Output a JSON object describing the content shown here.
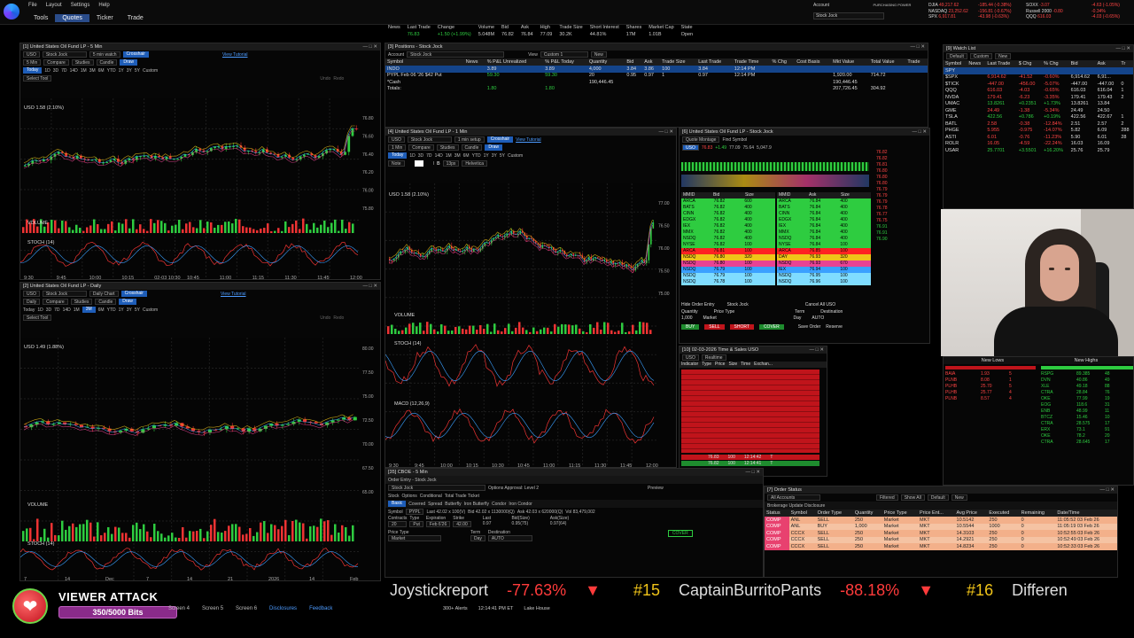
{
  "menu": {
    "items": [
      "File",
      "Layout",
      "Settings",
      "Help"
    ]
  },
  "nav": {
    "tabs": [
      "Tools",
      "Quotes",
      "Ticker",
      "Trade"
    ],
    "active": "Quotes"
  },
  "account": {
    "label": "Account",
    "value": "Stock Jock",
    "power_label": "PURCHASING POWER"
  },
  "indices": [
    {
      "name": "DJIA",
      "value": "49,217.62",
      "chg": "-185.44 (-0.38%)",
      "dir": "down"
    },
    {
      "name": "NASDAQ",
      "value": "23,252.62",
      "chg": "-156.81 (-0.67%)",
      "dir": "down"
    },
    {
      "name": "SPX",
      "value": "6,917.81",
      "chg": "-43.98 (-0.63%)",
      "dir": "down"
    },
    {
      "name": "SOXX",
      "value": "-3.07",
      "chg": "-4.63 (-1.05%)",
      "dir": "down"
    },
    {
      "name": "Russell 2000",
      "value": "-0.80",
      "chg": "-0.34%",
      "dir": "down"
    },
    {
      "name": "QQQ",
      "value": "616.03",
      "chg": "-4.03 (-0.65%)",
      "dir": "down"
    }
  ],
  "header_quote": {
    "labels": [
      "News",
      "Last Trade",
      "Change",
      "Volume",
      "Bid",
      "Ask",
      "High",
      "Trade Size",
      "Short Interest",
      "Shares",
      "Market Cap",
      "State"
    ],
    "values": [
      "",
      "76.83",
      "+1.50 (+1.99%)",
      "5.048M",
      "76.82",
      "76.84",
      "77.09",
      "30.2K",
      "44.81%",
      "17M",
      "1.01B",
      "Open"
    ]
  },
  "chart1": {
    "title": "[1] United States Oil Fund LP - 5 Min",
    "symbol": "USO",
    "account": "Stock Jock",
    "setup": "5 min watch",
    "crosshair": "Crosshair",
    "tutorial": "View Tutorial",
    "draw": "Draw",
    "compare": "Compare",
    "studies": "Studies",
    "type": "Candle",
    "interval": "5 Min",
    "periods": [
      "Today",
      "1D",
      "3D",
      "7D",
      "14D",
      "1M",
      "3M",
      "6M",
      "YTD",
      "1Y",
      "3Y",
      "5Y",
      "Custom"
    ],
    "select_tool": "Select Tool",
    "undo": "Undo",
    "redo": "Redo",
    "legend": "USO  1.58 (2.10%)",
    "volume_label": "VOLUME",
    "stoch_label": "STOCH (14)",
    "x_ticks": [
      "9:30",
      "9:45",
      "10:00",
      "10:15",
      "02-03 10:30",
      "10:45",
      "11:00",
      "11:15",
      "11:30",
      "11:45",
      "12:00"
    ],
    "y_ticks": [
      "76.80",
      "76.60",
      "76.40",
      "76.20",
      "76.00",
      "75.80"
    ]
  },
  "chart2": {
    "title": "[2] United States Oil Fund LP - Daily",
    "symbol": "USO",
    "setup": "Daily Chart",
    "interval": "Daily",
    "legend": "USO  1.49 (1.88%)",
    "volume_label": "VOLUME",
    "stoch_label": "STOCH (14)",
    "x_ticks": [
      "7",
      "14",
      "Dec",
      "7",
      "14",
      "21",
      "2026",
      "14",
      "Feb"
    ],
    "y_ticks": [
      "80.00",
      "77.50",
      "75.00",
      "72.50",
      "70.00",
      "67.50",
      "65.00"
    ]
  },
  "chart3": {
    "title": "[4] United States Oil Fund LP - 1 Min",
    "symbol": "USO",
    "setup": "1 min setup",
    "interval": "1 Min",
    "note": "Note",
    "font": "Helvetica",
    "font_size": "13px",
    "legend": "USO  1.58 (2.10%)",
    "volume_label": "VOLUME",
    "stoch_label": "STOCH (14)",
    "macd_label": "MACD (12,26,9)",
    "x_ticks": [
      "9:30",
      "9:45",
      "10:00",
      "10:15",
      "10:30",
      "10:45",
      "11:00",
      "11:15",
      "11:30",
      "11:45",
      "12:00"
    ],
    "y_ticks": [
      "77.00",
      "76.50",
      "76.00",
      "75.50",
      "75.00"
    ]
  },
  "positions": {
    "title": "[3] Positions - Stock Jock",
    "account_label": "Account",
    "account": "Stock Jock",
    "view_label": "View",
    "view": "Custom 1",
    "new": "New",
    "columns": [
      "Symbol",
      "News",
      "% P&L Unrealized",
      "% P&L Today",
      "Quantity",
      "Bid",
      "Ask",
      "Trade Size",
      "Last Trade",
      "Trade Time",
      "% Chg",
      "Cost Basis",
      "Mkt Value",
      "Total Value",
      "Trade"
    ],
    "rows": [
      [
        "INDO",
        "",
        "3.89",
        "3.89",
        "4,000",
        "3.84",
        "3.86",
        "100",
        "3.84",
        "12:14 PM",
        "",
        "",
        "",
        "",
        ""
      ],
      [
        "PYPL Feb 06 '26 $42 Put",
        "",
        "59.30",
        "59.30",
        "20",
        "0.95",
        "0.97",
        "1",
        "0.97",
        "12:14 PM",
        "",
        "",
        "1,920.00",
        "714.72",
        ""
      ],
      [
        "*Cash",
        "",
        "",
        "",
        "190,446.45",
        "",
        "",
        "",
        "",
        "",
        "",
        "",
        "190,446.45",
        "",
        ""
      ],
      [
        "Totals:",
        "",
        "1.80",
        "1.80",
        "",
        "",
        "",
        "",
        "",
        "",
        "",
        "",
        "207,726.45",
        "304.92",
        ""
      ]
    ]
  },
  "level2": {
    "title": "[6] United States Oil Fund LP - Stock Jock",
    "view": "Quote Montage",
    "find": "Find Symbol",
    "symbol": "USO",
    "last": "76.83",
    "chg": "+1.49",
    "high": "77.09",
    "low": "75.64",
    "vol": "5,047.9",
    "bid_cols": [
      "MMID",
      "Bid",
      "Size"
    ],
    "ask_cols": [
      "MMID",
      "Ask",
      "Size"
    ],
    "bids": [
      [
        "ARCA",
        "76.82",
        "600"
      ],
      [
        "BATS",
        "76.82",
        "400"
      ],
      [
        "CINN",
        "76.82",
        "400"
      ],
      [
        "EDGX",
        "76.82",
        "400"
      ],
      [
        "IEX",
        "76.82",
        "400"
      ],
      [
        "MMX",
        "76.82",
        "400"
      ],
      [
        "NSDQ",
        "76.82",
        "400"
      ],
      [
        "NYSE",
        "76.82",
        "100"
      ],
      [
        "ARCA",
        "76.81",
        "100"
      ],
      [
        "NSDQ",
        "76.80",
        "320"
      ],
      [
        "NSDQ",
        "76.80",
        "100"
      ],
      [
        "NSDQ",
        "76.79",
        "100"
      ],
      [
        "NSDQ",
        "76.79",
        "100"
      ],
      [
        "NSDQ",
        "76.78",
        "100"
      ]
    ],
    "asks": [
      [
        "ARCA",
        "76.84",
        "400"
      ],
      [
        "BATS",
        "76.84",
        "400"
      ],
      [
        "CINN",
        "76.84",
        "400"
      ],
      [
        "EDGX",
        "76.84",
        "400"
      ],
      [
        "IEX",
        "76.84",
        "400"
      ],
      [
        "MMX",
        "76.84",
        "400"
      ],
      [
        "NSDQ",
        "76.84",
        "400"
      ],
      [
        "NYSE",
        "76.84",
        "100"
      ],
      [
        "ARCA",
        "76.85",
        "100"
      ],
      [
        "DAY",
        "76.93",
        "320"
      ],
      [
        "NSDQ",
        "76.93",
        "670"
      ],
      [
        "IEX",
        "76.94",
        "100"
      ],
      [
        "NSDQ",
        "76.95",
        "100"
      ],
      [
        "NSDQ",
        "76.96",
        "100"
      ]
    ],
    "ticks": [
      "76.82",
      "76.82",
      "76.81",
      "76.80",
      "76.80",
      "76.80",
      "76.79",
      "76.79",
      "76.79",
      "76.78",
      "76.77",
      "76.75",
      "76.91",
      "76.91",
      "76.90"
    ],
    "order_entry": {
      "hide": "Hide Order Entry",
      "account": "Stock Jock",
      "cancel": "Cancel All USO",
      "quantity_label": "Quantity",
      "quantity": "1,000",
      "price_type_label": "Price Type",
      "price_type": "Market",
      "term_label": "Term",
      "term": "Day",
      "destination_label": "Destination",
      "destination": "AUTO",
      "buttons": [
        "BUY",
        "SELL",
        "SHORT",
        "COVER"
      ],
      "save_order": "Save Order",
      "reserve": "Reserve"
    }
  },
  "timesales": {
    "title": "[10] 02-03-2026 Time & Sales USO",
    "symbol": "USO",
    "mode": "Realtime",
    "columns": [
      "Indicator",
      "Type",
      "Price",
      "Size",
      "Time",
      "Exchan..."
    ],
    "last_rows": [
      [
        "",
        "T",
        "76.83",
        "100",
        "12:14:42",
        "T"
      ],
      [
        "",
        "T",
        "76.82",
        "100",
        "12:14:41",
        "T"
      ]
    ]
  },
  "watchlist": {
    "title": "[9] Watch List",
    "views": "Custom",
    "new": "New",
    "default": "Default",
    "columns": [
      "Symbol",
      "News",
      "Last Trade",
      "$ Chg",
      "% Chg",
      "Bid",
      "Ask",
      "Tr"
    ],
    "rows": [
      [
        "SPY",
        "",
        "",
        "",
        "",
        "",
        "",
        ""
      ],
      [
        "$SPX",
        "",
        "6,914.62",
        "-41.52",
        "-0.60%",
        "6,914.62",
        "6,91...",
        ""
      ],
      [
        "$TICK",
        "",
        "-447.00",
        "-456.00",
        "-5.07%",
        "-447.00",
        "-447.00",
        "0"
      ],
      [
        "QQQ",
        "",
        "616.03",
        "-4.03",
        "-0.65%",
        "616.03",
        "616.04",
        "1"
      ],
      [
        "NVDA",
        "",
        "179.41",
        "-6.23",
        "-3.35%",
        "179.41",
        "179.43",
        "2"
      ],
      [
        "UMAC",
        "",
        "13.8261",
        "+0.2351",
        "+1.73%",
        "13.8261",
        "13.84",
        ""
      ],
      [
        "GME",
        "",
        "24.49",
        "-1.38",
        "-5.34%",
        "24.49",
        "24.50",
        ""
      ],
      [
        "TSLA",
        "",
        "422.56",
        "+0.786",
        "+0.19%",
        "422.56",
        "422.67",
        "1"
      ],
      [
        "BATL",
        "",
        "2.58",
        "-0.38",
        "-12.84%",
        "2.51",
        "2.57",
        "2"
      ],
      [
        "PHGE",
        "",
        "5.955",
        "-0.975",
        "-14.07%",
        "5.82",
        "6.09",
        "288"
      ],
      [
        "ASTI",
        "",
        "6.01",
        "-0.76",
        "-11.23%",
        "5.90",
        "6.01",
        "28"
      ],
      [
        "ROLR",
        "",
        "16.05",
        "-4.59",
        "-22.24%",
        "16.03",
        "16.09",
        ""
      ],
      [
        "USAR",
        "",
        "25.7701",
        "+3.5501",
        "+16.20%",
        "25.76",
        "25.79",
        ""
      ]
    ]
  },
  "lows_highs": {
    "lows_label": "New Lows",
    "highs_label": "New Highs",
    "columns": [
      "Symbol",
      "Price",
      "Count"
    ],
    "lows": [
      [
        "BAIA",
        "1.93",
        "5"
      ],
      [
        "PLNB",
        "8.08",
        "1"
      ],
      [
        "PLHB",
        "25.70",
        "5"
      ],
      [
        "PLHB",
        "25.77",
        "4"
      ],
      [
        "PLNB",
        "8.57",
        "4"
      ]
    ],
    "highs": [
      [
        "RSPG",
        "89.385",
        "48"
      ],
      [
        "DVN",
        "40.86",
        "49"
      ],
      [
        "XLE",
        "49.18",
        "88"
      ],
      [
        "CTRA",
        "28.84",
        "76"
      ],
      [
        "OKE",
        "77.99",
        "19"
      ],
      [
        "EOG",
        "118.6",
        "31"
      ],
      [
        "ENB",
        "48.99",
        "11"
      ],
      [
        "BTCZ",
        "15.46",
        "10"
      ],
      [
        "CTRA",
        "28.575",
        "17"
      ],
      [
        "ERX",
        "73.1",
        "91"
      ],
      [
        "OKE",
        "78.2",
        "20"
      ],
      [
        "CTRA",
        "28.645",
        "17"
      ]
    ]
  },
  "options_entry": {
    "title": "[35] CBOE - 5 Min",
    "subtitle": "Order Entry - Stock Jock",
    "account": "Stock Jock",
    "approval": "Options Approval: Level 2",
    "preview": "Preview",
    "tabs": [
      "Stock",
      "Options",
      "Conditional",
      "Total Trade Ticket"
    ],
    "strategies": [
      "Basic",
      "Covered",
      "Spread",
      "Butterfly",
      "Iron Butterfly",
      "Condor",
      "Iron Condor"
    ],
    "symbol_label": "Symbol",
    "symbol": "PYPL",
    "last": "Last 42.02 x 100(V)",
    "bid": "Bid 42.02 x 1130000(Q)",
    "ask": "Ask 42.03 x 620000(Q)",
    "vol": "Vol 83,479,002",
    "contracts_label": "Contracts",
    "contracts": "20",
    "type_label": "Type",
    "type": "Put",
    "expiration_label": "Expiration",
    "expiration": "Feb 6'26",
    "strike_label": "Strike",
    "strike": "42.00",
    "opt_last_label": "Last",
    "opt_last": "0.97",
    "bidsize_label": "Bid(Size)",
    "bidsize": "0.95(75)",
    "asksize_label": "Ask(Size)",
    "asksize": "0.97(64)",
    "price_type_label": "Price Type",
    "price_type": "Market",
    "term_label": "Term",
    "term": "Day",
    "dest_label": "Destination",
    "dest": "AUTO",
    "cover": "COVER"
  },
  "order_status": {
    "title": "[7] Order Status",
    "account": "All Accounts",
    "status": "Filtered",
    "symbol": "Show All",
    "views": "Default",
    "new": "New",
    "disclosure": "Brokerage Update Disclosure",
    "columns": [
      "Status",
      "Symbol",
      "Order Type",
      "Quantity",
      "Price Type",
      "Price Ent...",
      "Avg Price",
      "Executed",
      "Remaining",
      "Date/Time"
    ],
    "rows": [
      [
        "COMP",
        "ANL",
        "SELL",
        "250",
        "Market",
        "MKT",
        "10.5142",
        "250",
        "0",
        "11:05:52 03 Feb 26"
      ],
      [
        "COMP",
        "ANL",
        "BUY",
        "1,000",
        "Market",
        "MKT",
        "10.5544",
        "1000",
        "0",
        "11:05:19 03 Feb 26"
      ],
      [
        "COMP",
        "CCCX",
        "SELL",
        "250",
        "Market",
        "MKT",
        "14.3103",
        "250",
        "0",
        "10:52:55 03 Feb 26"
      ],
      [
        "COMP",
        "CCCX",
        "SELL",
        "250",
        "Market",
        "MKT",
        "14.2921",
        "250",
        "0",
        "10:52:49 03 Feb 26"
      ],
      [
        "COMP",
        "CCCX",
        "SELL",
        "250",
        "Market",
        "MKT",
        "14.8234",
        "250",
        "0",
        "10:52:33 03 Feb 26"
      ]
    ]
  },
  "overlay": {
    "viewer_title": "VIEWER ATTACK",
    "bits": "350/5000 Bits",
    "ticker": [
      {
        "rank": "",
        "name": "Joystickreport",
        "pct": "-77.63%"
      },
      {
        "rank": "#15",
        "name": "CaptainBurritoPants",
        "pct": "-88.18%"
      },
      {
        "rank": "#16",
        "name": "Differen",
        "pct": ""
      }
    ]
  },
  "bottom": {
    "screens": [
      "Screen 4",
      "Screen 5",
      "Screen 6"
    ],
    "links": [
      "Disclosures",
      "Feedback"
    ],
    "status": [
      "300+ Alerts",
      "12:14:41 PM ET",
      "Lake House"
    ]
  }
}
